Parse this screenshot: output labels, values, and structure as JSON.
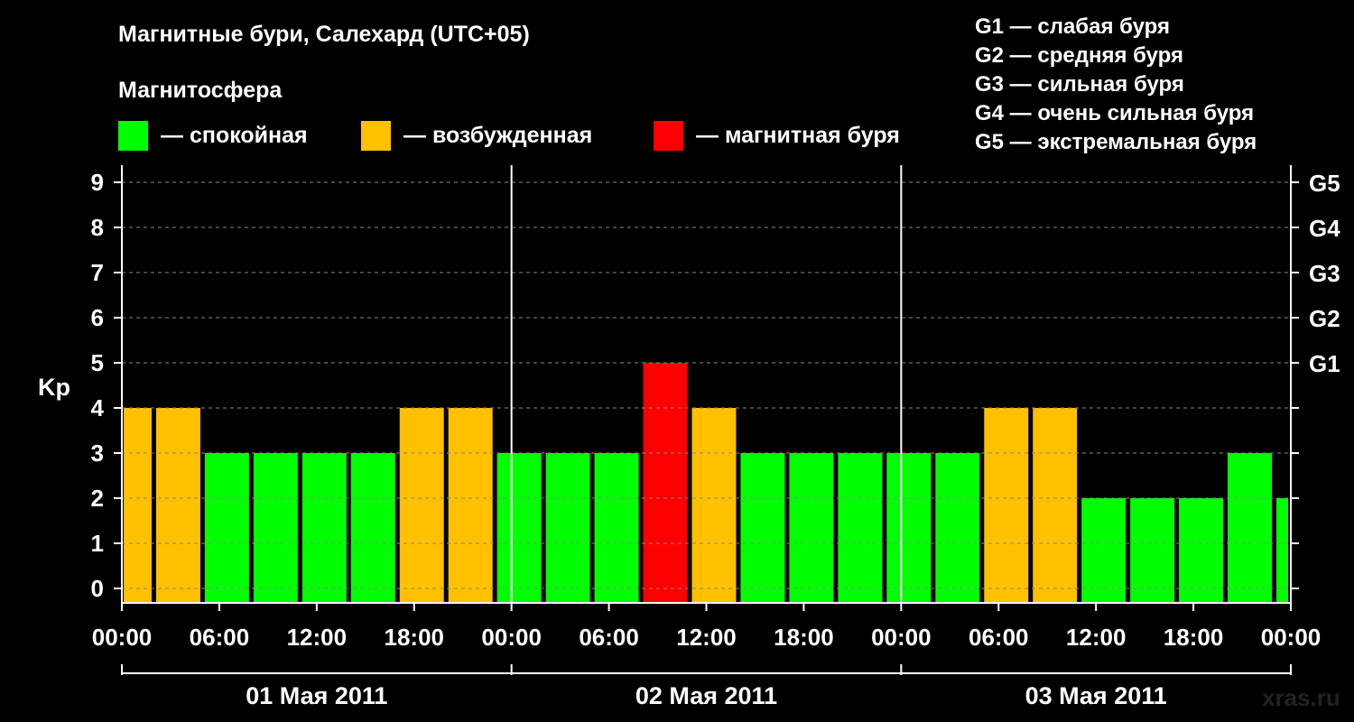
{
  "header": {
    "title": "Магнитные бури, Салехард (UTC+05)",
    "subtitle": "Магнитосфера"
  },
  "legend": [
    {
      "label": "— спокойная",
      "color": "#00ff00"
    },
    {
      "label": "— возбужденная",
      "color": "#ffc000"
    },
    {
      "label": "— магнитная буря",
      "color": "#ff0000"
    }
  ],
  "storm_levels": [
    "G1 — слабая буря",
    "G2 — средняя буря",
    "G3 — сильная буря",
    "G4 — очень сильная буря",
    "G5 — экстремальная буря"
  ],
  "watermark": "xras.ru",
  "chart_data": {
    "type": "bar",
    "title": "Магнитные бури, Салехард (UTC+05)",
    "ylabel": "Kp",
    "ylim": [
      0,
      9
    ],
    "yticks": [
      "0",
      "1",
      "2",
      "3",
      "4",
      "5",
      "6",
      "7",
      "8",
      "9"
    ],
    "right_ticks": [
      {
        "kp": 5,
        "label": "G1"
      },
      {
        "kp": 6,
        "label": "G2"
      },
      {
        "kp": 7,
        "label": "G3"
      },
      {
        "kp": 8,
        "label": "G4"
      },
      {
        "kp": 9,
        "label": "G5"
      }
    ],
    "xlim_hours": [
      0,
      72
    ],
    "xticks": [
      {
        "hour": 0,
        "label": "00:00"
      },
      {
        "hour": 6,
        "label": "06:00"
      },
      {
        "hour": 12,
        "label": "12:00"
      },
      {
        "hour": 18,
        "label": "18:00"
      },
      {
        "hour": 24,
        "label": "00:00"
      },
      {
        "hour": 30,
        "label": "06:00"
      },
      {
        "hour": 36,
        "label": "12:00"
      },
      {
        "hour": 42,
        "label": "18:00"
      },
      {
        "hour": 48,
        "label": "00:00"
      },
      {
        "hour": 54,
        "label": "06:00"
      },
      {
        "hour": 60,
        "label": "12:00"
      },
      {
        "hour": 66,
        "label": "18:00"
      },
      {
        "hour": 72,
        "label": "00:00"
      }
    ],
    "days": [
      {
        "label": "01 Мая 2011",
        "start": 0,
        "end": 24
      },
      {
        "label": "02 Мая 2011",
        "start": 24,
        "end": 48
      },
      {
        "label": "03 Мая 2011",
        "start": 48,
        "end": 72
      }
    ],
    "grid": "horizontal dashed",
    "legend_position": "top",
    "bars": [
      {
        "start": 0,
        "end": 2,
        "kp": 4,
        "color": "#ffc000"
      },
      {
        "start": 2,
        "end": 5,
        "kp": 4,
        "color": "#ffc000"
      },
      {
        "start": 5,
        "end": 8,
        "kp": 3,
        "color": "#00ff00"
      },
      {
        "start": 8,
        "end": 11,
        "kp": 3,
        "color": "#00ff00"
      },
      {
        "start": 11,
        "end": 14,
        "kp": 3,
        "color": "#00ff00"
      },
      {
        "start": 14,
        "end": 17,
        "kp": 3,
        "color": "#00ff00"
      },
      {
        "start": 17,
        "end": 20,
        "kp": 4,
        "color": "#ffc000"
      },
      {
        "start": 20,
        "end": 23,
        "kp": 4,
        "color": "#ffc000"
      },
      {
        "start": 23,
        "end": 26,
        "kp": 3,
        "color": "#00ff00"
      },
      {
        "start": 26,
        "end": 29,
        "kp": 3,
        "color": "#00ff00"
      },
      {
        "start": 29,
        "end": 32,
        "kp": 3,
        "color": "#00ff00"
      },
      {
        "start": 32,
        "end": 35,
        "kp": 5,
        "color": "#ff0000"
      },
      {
        "start": 35,
        "end": 38,
        "kp": 4,
        "color": "#ffc000"
      },
      {
        "start": 38,
        "end": 41,
        "kp": 3,
        "color": "#00ff00"
      },
      {
        "start": 41,
        "end": 44,
        "kp": 3,
        "color": "#00ff00"
      },
      {
        "start": 44,
        "end": 47,
        "kp": 3,
        "color": "#00ff00"
      },
      {
        "start": 47,
        "end": 50,
        "kp": 3,
        "color": "#00ff00"
      },
      {
        "start": 50,
        "end": 53,
        "kp": 3,
        "color": "#00ff00"
      },
      {
        "start": 53,
        "end": 56,
        "kp": 4,
        "color": "#ffc000"
      },
      {
        "start": 56,
        "end": 59,
        "kp": 4,
        "color": "#ffc000"
      },
      {
        "start": 59,
        "end": 62,
        "kp": 2,
        "color": "#00ff00"
      },
      {
        "start": 62,
        "end": 65,
        "kp": 2,
        "color": "#00ff00"
      },
      {
        "start": 65,
        "end": 68,
        "kp": 2,
        "color": "#00ff00"
      },
      {
        "start": 68,
        "end": 71,
        "kp": 3,
        "color": "#00ff00"
      },
      {
        "start": 71,
        "end": 72,
        "kp": 2,
        "color": "#00ff00"
      }
    ]
  }
}
